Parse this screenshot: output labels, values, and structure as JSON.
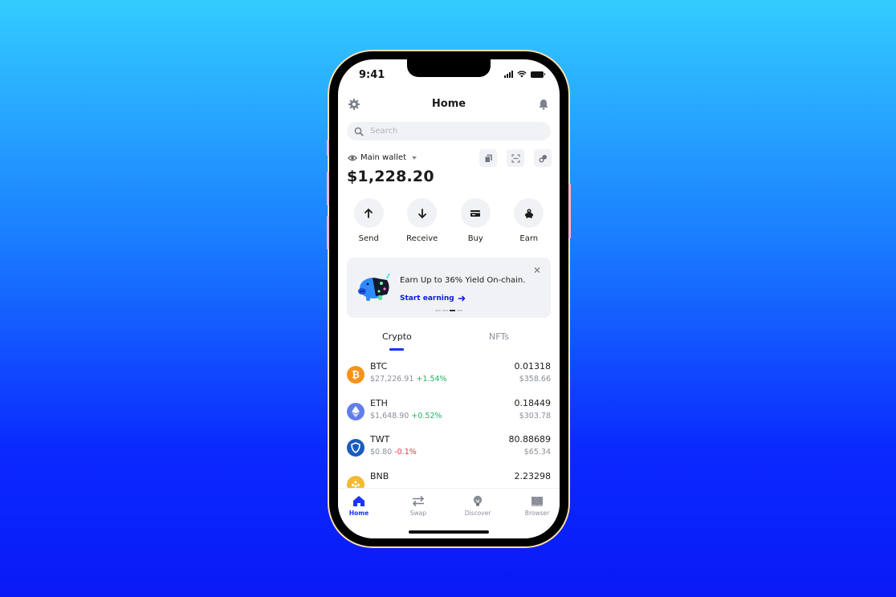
{
  "status_bar": {
    "time": "9:41"
  },
  "header": {
    "title": "Home"
  },
  "search": {
    "placeholder": "Search"
  },
  "wallet": {
    "name": "Main wallet",
    "balance": "$1,228.20"
  },
  "actions": [
    {
      "label": "Send",
      "icon": "arrow-up-icon"
    },
    {
      "label": "Receive",
      "icon": "arrow-down-icon"
    },
    {
      "label": "Buy",
      "icon": "card-icon"
    },
    {
      "label": "Earn",
      "icon": "earn-icon"
    }
  ],
  "banner": {
    "title": "Earn Up to 36% Yield On-chain.",
    "link_label": "Start earning",
    "close_glyph": "✕",
    "page_count": 4,
    "active_page": 3
  },
  "tabs": [
    {
      "label": "Crypto",
      "active": true
    },
    {
      "label": "NFTs",
      "active": false
    }
  ],
  "assets": [
    {
      "symbol": "BTC",
      "price": "$27,226.91",
      "change": "+1.54%",
      "direction": "up",
      "amount": "0.01318",
      "value": "$358.66",
      "color": "#f7931a",
      "glyph": "₿"
    },
    {
      "symbol": "ETH",
      "price": "$1,648.90",
      "change": "+0.52%",
      "direction": "up",
      "amount": "0.18449",
      "value": "$303.78",
      "color": "#627eea",
      "glyph": "◆"
    },
    {
      "symbol": "TWT",
      "price": "$0.80",
      "change": "-0.1%",
      "direction": "down",
      "amount": "80.88689",
      "value": "$65.34",
      "color": "#1a5bbf",
      "glyph": ""
    },
    {
      "symbol": "BNB",
      "price": "",
      "change": "",
      "direction": "up",
      "amount": "2.23298",
      "value": "",
      "color": "#f3ba2f",
      "glyph": ""
    }
  ],
  "tabbar": [
    {
      "label": "Home",
      "active": true
    },
    {
      "label": "Swap",
      "active": false
    },
    {
      "label": "Discover",
      "active": false
    },
    {
      "label": "Browser",
      "active": false
    }
  ],
  "colors": {
    "accent": "#1a33ff",
    "positive": "#20b463",
    "negative": "#e8334a"
  }
}
